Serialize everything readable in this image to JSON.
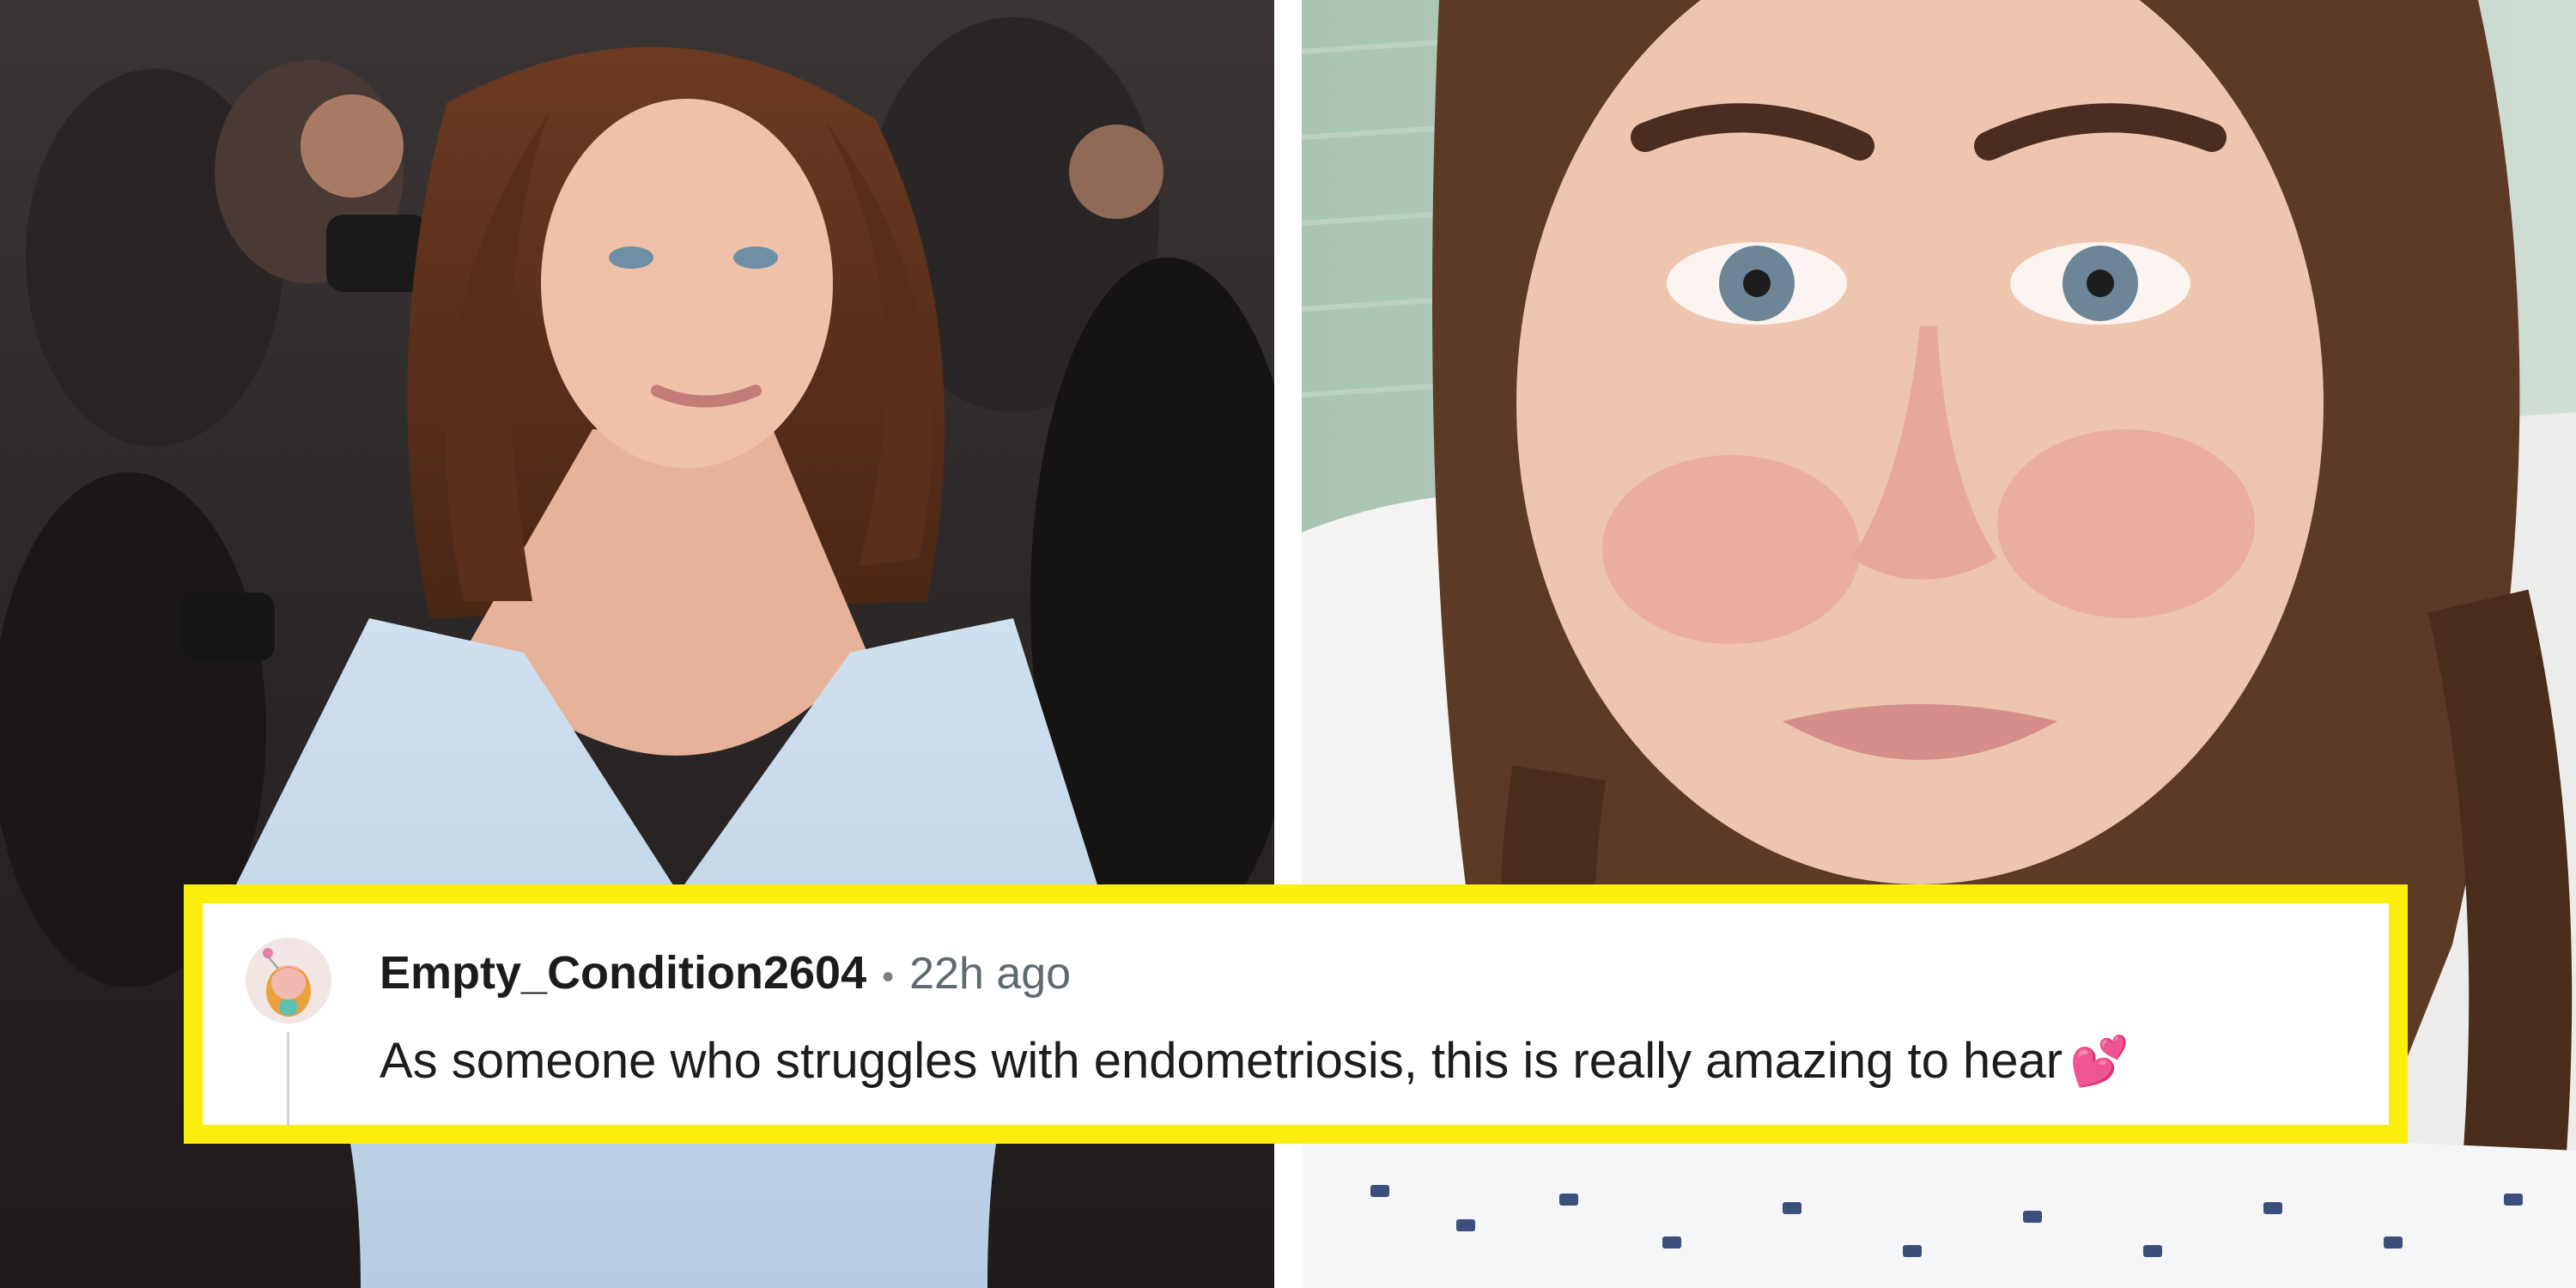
{
  "photos": {
    "left": {
      "subject": "woman in pale blue gown on red carpet with photographers behind"
    },
    "right": {
      "subject": "close-up selfie of woman in hospital bed with braided hair"
    }
  },
  "comment": {
    "username": "Empty_Condition2604",
    "separator": "•",
    "timestamp": "22h ago",
    "text": "As someone who struggles with endometriosis, this is really amazing to hear",
    "emoji": "💕",
    "avatar_icon": "reddit-avatar-icon"
  },
  "colors": {
    "highlight_border": "#fbed0c",
    "username": "#1c1c1c",
    "timestamp": "#5e6a70"
  }
}
